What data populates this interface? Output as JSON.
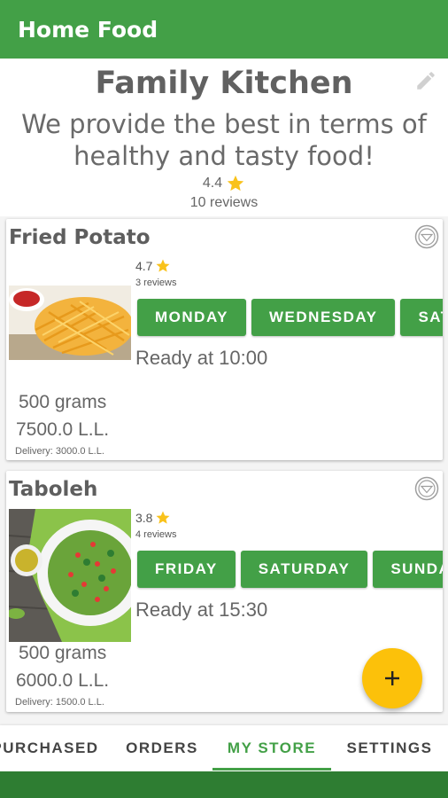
{
  "appbar": {
    "title": "Home Food"
  },
  "store": {
    "name": "Family Kitchen",
    "description": "We provide the best in terms of healthy and tasty food!",
    "rating": "4.4",
    "reviews": "10 reviews"
  },
  "items": [
    {
      "title": "Fried Potato",
      "rating": "4.7",
      "reviews": "3 reviews",
      "days": [
        "MONDAY",
        "WEDNESDAY",
        "SATURDAY"
      ],
      "ready": "Ready at 10:00",
      "grams": "500 grams",
      "price": "7500.0 L.L.",
      "delivery": "Delivery: 3000.0 L.L."
    },
    {
      "title": "Taboleh",
      "rating": "3.8",
      "reviews": "4 reviews",
      "days": [
        "FRIDAY",
        "SATURDAY",
        "SUNDAY"
      ],
      "ready": "Ready at 15:30",
      "grams": "500 grams",
      "price": "6000.0 L.L.",
      "delivery": "Delivery: 1500.0 L.L."
    }
  ],
  "tabs": [
    "PURCHASED",
    "ORDERS",
    "MY STORE",
    "SETTINGS"
  ],
  "active_tab": "MY STORE",
  "colors": {
    "primary": "#43a047",
    "accent": "#fcc10a",
    "star": "#f9c21b"
  }
}
